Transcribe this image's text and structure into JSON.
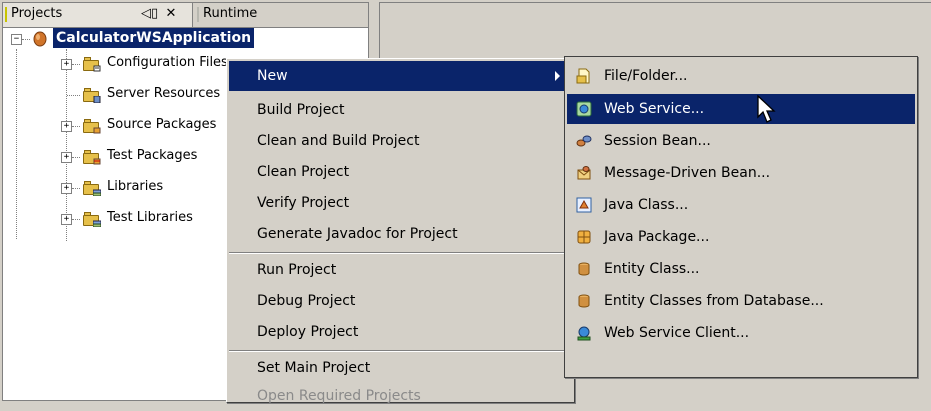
{
  "tabs": {
    "projects_label": "Projects",
    "projects_buttons": [
      "◁▯",
      "✕"
    ],
    "runtime_label": "Runtime"
  },
  "tree": {
    "root": {
      "label": "CalculatorWSApplication",
      "expander": "−"
    },
    "children": [
      {
        "label": "Configuration Files",
        "expander": "+"
      },
      {
        "label": "Server Resources",
        "expander": ""
      },
      {
        "label": "Source Packages",
        "expander": "+"
      },
      {
        "label": "Test Packages",
        "expander": "+"
      },
      {
        "label": "Libraries",
        "expander": "+"
      },
      {
        "label": "Test Libraries",
        "expander": "+"
      }
    ]
  },
  "context_menu": {
    "items": [
      {
        "label": "New",
        "selected": true,
        "has_submenu": true
      },
      {
        "label": "Build Project"
      },
      {
        "label": "Clean and Build Project"
      },
      {
        "label": "Clean Project"
      },
      {
        "label": "Verify Project"
      },
      {
        "label": "Generate Javadoc for Project"
      },
      {
        "label": "Run Project"
      },
      {
        "label": "Debug Project"
      },
      {
        "label": "Deploy Project"
      },
      {
        "label": "Set Main Project"
      },
      {
        "label": "Open Required Projects",
        "disabled": true
      }
    ]
  },
  "submenu": {
    "items": [
      {
        "label": "File/Folder...",
        "icon": "file-folder-icon"
      },
      {
        "label": "Web Service...",
        "icon": "web-service-icon",
        "selected": true
      },
      {
        "label": "Session Bean...",
        "icon": "session-bean-icon"
      },
      {
        "label": "Message-Driven Bean...",
        "icon": "message-driven-bean-icon"
      },
      {
        "label": "Java Class...",
        "icon": "java-class-icon"
      },
      {
        "label": "Java Package...",
        "icon": "java-package-icon"
      },
      {
        "label": "Entity Class...",
        "icon": "entity-class-icon"
      },
      {
        "label": "Entity Classes from Database...",
        "icon": "entity-classes-db-icon"
      },
      {
        "label": "Web Service Client...",
        "icon": "web-service-client-icon"
      }
    ]
  },
  "colors": {
    "selection": "#0a246a",
    "panel": "#d4d0c8",
    "folder": "#e6c04a"
  }
}
